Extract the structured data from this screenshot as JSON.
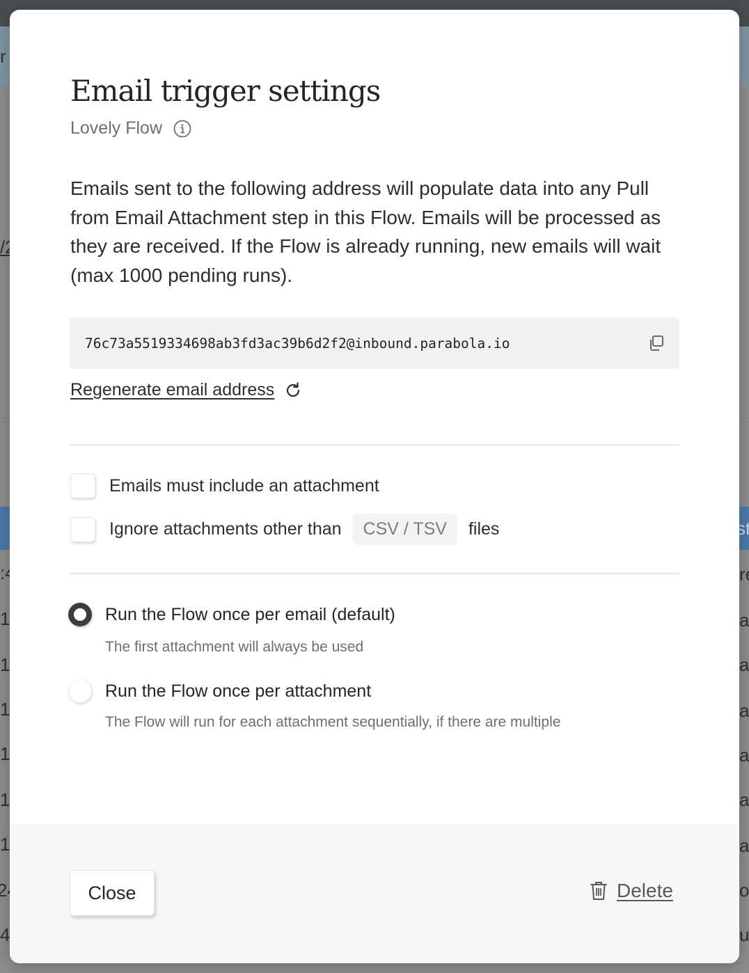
{
  "background": {
    "left_fragments": [
      "r",
      "/2",
      ":4",
      "1",
      "1",
      "1",
      "1",
      "1",
      "1",
      "24",
      "4"
    ],
    "right_fragments": [
      "st",
      "re",
      "ar",
      "ar",
      "ar",
      "ar",
      "ar",
      "ar",
      "ov",
      "u"
    ]
  },
  "modal": {
    "title": "Email trigger settings",
    "subtitle": "Lovely Flow",
    "info_icon": "info-icon",
    "description": "Emails sent to the following address will populate data into any Pull from Email Attachment step in this Flow. Emails will be processed as they are received. If the Flow is already running, new emails will wait (max 1000 pending runs).",
    "email_address": "76c73a5519334698ab3fd3ac39b6d2f2@inbound.parabola.io",
    "copy_icon": "copy-icon",
    "regenerate_label": "Regenerate email address",
    "refresh_icon": "refresh-icon",
    "checkboxes": {
      "require_attachment": {
        "label": "Emails must include an attachment",
        "checked": false
      },
      "ignore_other": {
        "label_before": "Ignore attachments other than",
        "file_type": "CSV / TSV",
        "label_after": "files",
        "checked": false
      }
    },
    "run_options": [
      {
        "label": "Run the Flow once per email (default)",
        "description": "The first attachment will always be used",
        "selected": true
      },
      {
        "label": "Run the Flow once per attachment",
        "description": "The Flow will run for each attachment sequentially, if there are multiple",
        "selected": false
      }
    ],
    "footer": {
      "close_label": "Close",
      "delete_label": "Delete",
      "trash_icon": "trash-icon"
    }
  }
}
